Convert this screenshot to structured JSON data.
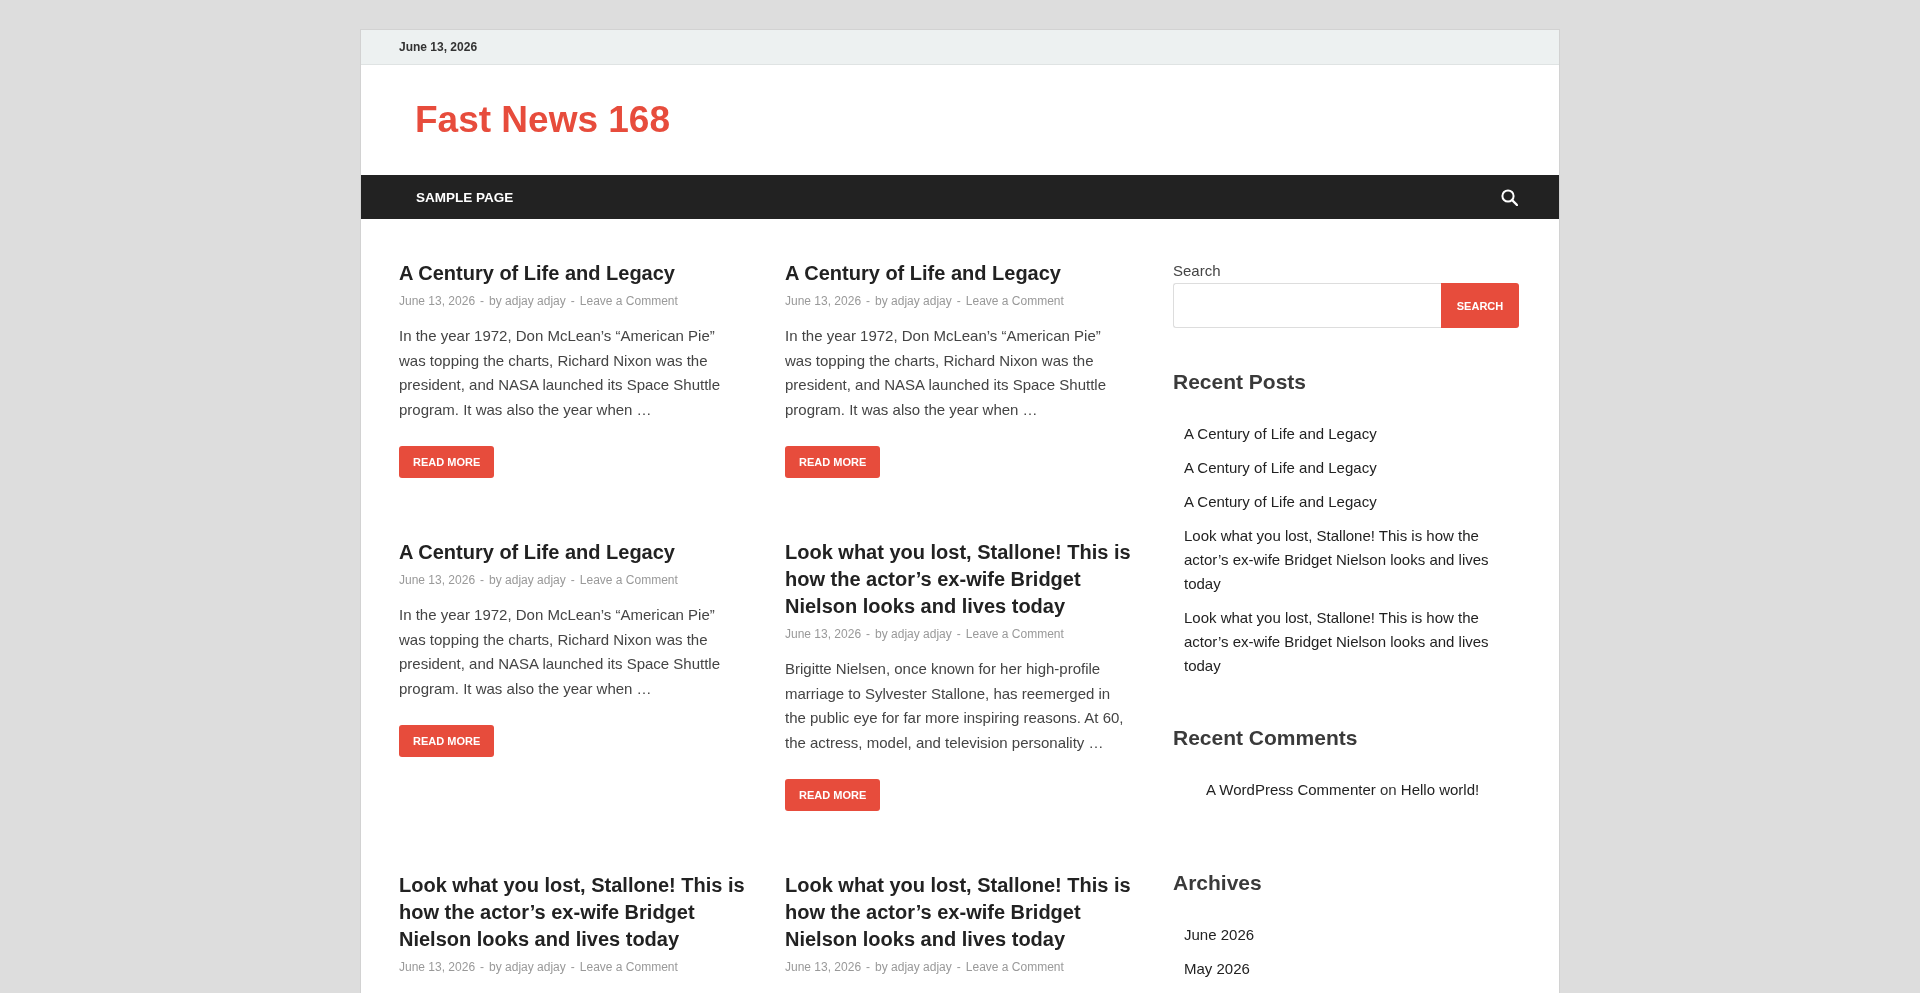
{
  "top_bar": {
    "date": "June 13, 2026"
  },
  "header": {
    "site_title": "Fast News 168"
  },
  "nav": {
    "items": [
      {
        "label": "SAMPLE PAGE"
      }
    ]
  },
  "posts": [
    {
      "title": "A Century of Life and Legacy",
      "meta": [
        "June 13, 2026",
        "-",
        "by adjay adjay",
        "-",
        "Leave a Comment"
      ],
      "excerpt": "In the year 1972, Don McLean’s “American Pie” was topping the charts, Richard Nixon was the president, and NASA launched its Space Shuttle program. It was also the year when …",
      "button": "READ MORE"
    },
    {
      "title": "A Century of Life and Legacy",
      "meta": [
        "June 13, 2026",
        "-",
        "by adjay adjay",
        "-",
        "Leave a Comment"
      ],
      "excerpt": "In the year 1972, Don McLean’s “American Pie” was topping the charts, Richard Nixon was the president, and NASA launched its Space Shuttle program. It was also the year when …",
      "button": "READ MORE"
    },
    {
      "title": "A Century of Life and Legacy",
      "meta": [
        "June 13, 2026",
        "-",
        "by adjay adjay",
        "-",
        "Leave a Comment"
      ],
      "excerpt": "In the year 1972, Don McLean’s “American Pie” was topping the charts, Richard Nixon was the president, and NASA launched its Space Shuttle program. It was also the year when …",
      "button": "READ MORE"
    },
    {
      "title": "Look what you lost, Stallone! This is how the actor’s ex-wife Bridget Nielson looks and lives today",
      "meta": [
        "June 13, 2026",
        "-",
        "by adjay adjay",
        "-",
        "Leave a Comment"
      ],
      "excerpt": "Brigitte Nielsen, once known for her high-profile marriage to Sylvester Stallone, has reemerged in the public eye for far more inspiring reasons. At 60, the actress, model, and television personality …",
      "button": "READ MORE"
    },
    {
      "title": "Look what you lost, Stallone! This is how the actor’s ex-wife Bridget Nielson looks and lives today",
      "meta": [
        "June 13, 2026",
        "-",
        "by adjay adjay",
        "-",
        "Leave a Comment"
      ]
    },
    {
      "title": "Look what you lost, Stallone! This is how the actor’s ex-wife Bridget Nielson looks and lives today",
      "meta": [
        "June 13, 2026",
        "-",
        "by adjay adjay",
        "-",
        "Leave a Comment"
      ]
    }
  ],
  "sidebar": {
    "search": {
      "label": "Search",
      "button": "SEARCH"
    },
    "widgets": [
      {
        "kind": "recent_posts",
        "title": "Recent Posts",
        "items": [
          "A Century of Life and Legacy",
          "A Century of Life and Legacy",
          "A Century of Life and Legacy",
          "Look what you lost, Stallone! This is how the actor’s ex-wife Bridget Nielson looks and lives today",
          "Look what you lost, Stallone! This is how the actor’s ex-wife Bridget Nielson looks and lives today"
        ]
      },
      {
        "kind": "recent_comments",
        "title": "Recent Comments",
        "items": [
          {
            "author": "A WordPress Commenter",
            "connector": "on",
            "post": "Hello world!"
          }
        ]
      },
      {
        "kind": "archives",
        "title": "Archives",
        "items": [
          "June 2026",
          "May 2026"
        ]
      }
    ]
  }
}
